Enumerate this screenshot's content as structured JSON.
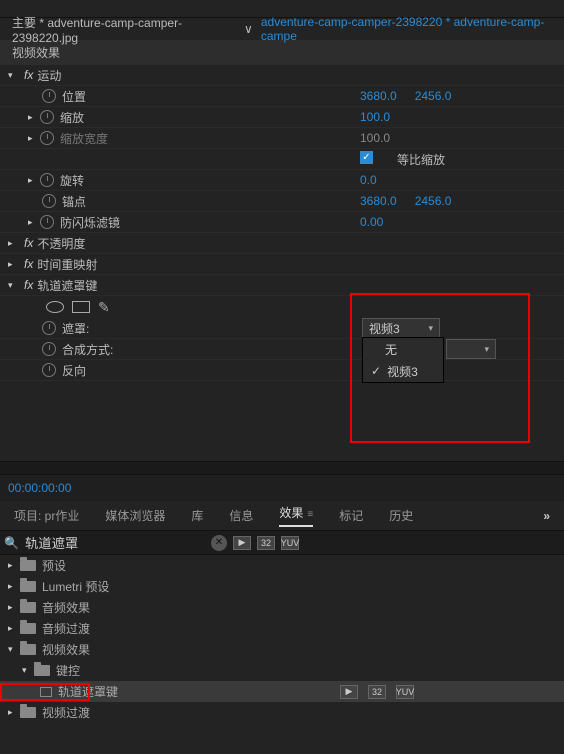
{
  "breadcrumb": {
    "main": "主要 * adventure-camp-camper-2398220.jpg",
    "sep": "∨",
    "link": "adventure-camp-camper-2398220 * adventure-camp-campe"
  },
  "section_head": "视频效果",
  "motion": {
    "title": "运动",
    "position": {
      "label": "位置",
      "x": "3680.0",
      "y": "2456.0"
    },
    "scale": {
      "label": "缩放",
      "v": "100.0"
    },
    "scale_w": {
      "label": "缩放宽度",
      "v": "100.0"
    },
    "uniform": {
      "label": "等比缩放"
    },
    "rotation": {
      "label": "旋转",
      "v": "0.0"
    },
    "anchor": {
      "label": "锚点",
      "x": "3680.0",
      "y": "2456.0"
    },
    "flicker": {
      "label": "防闪烁滤镜",
      "v": "0.00"
    }
  },
  "opacity": {
    "title": "不透明度"
  },
  "timeremap": {
    "title": "时间重映射"
  },
  "trackmatte": {
    "title": "轨道遮罩键",
    "matte_label": "遮罩:",
    "matte_value": "视频3",
    "composite_label": "合成方式:",
    "reverse_label": "反向",
    "options": {
      "none": "无",
      "video3": "视频3"
    }
  },
  "timecode": "00:00:00:00",
  "lowerTabs": {
    "project": "项目: pr作业",
    "media": "媒体浏览器",
    "library": "库",
    "info": "信息",
    "effects": "效果",
    "markers": "标记",
    "history": "历史"
  },
  "search": {
    "value": "轨道遮罩"
  },
  "badges": {
    "b1": "▶",
    "b2": "32",
    "b3": "YUV"
  },
  "tree": {
    "presets": "预设",
    "lumetri": "Lumetri 预设",
    "audiofx": "音频效果",
    "audiotr": "音频过渡",
    "videofx": "视频效果",
    "keying": "键控",
    "trackmatte": "轨道遮罩键",
    "videotr": "视频过渡"
  }
}
